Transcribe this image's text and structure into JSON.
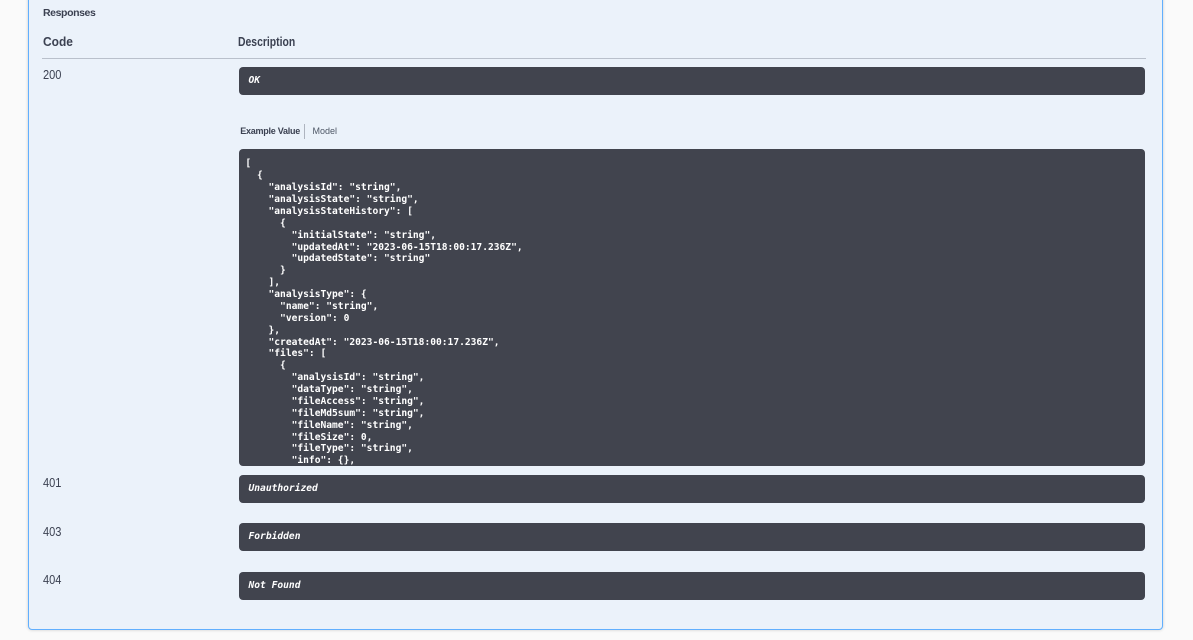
{
  "colors": {
    "panel_background": "#ebf2fa",
    "panel_border": "#61affe",
    "dark_block": "#41444e",
    "text": "#3b4151",
    "page_background": "#fafafa"
  },
  "responses_section": {
    "title": "Responses",
    "table": {
      "headers": {
        "code": "Code",
        "description": "Description"
      },
      "rows": [
        {
          "code": "200",
          "description": "OK",
          "tabs": [
            {
              "label": "Example Value",
              "active": true
            },
            {
              "label": "Model",
              "active": false
            }
          ],
          "example": "[\n  {\n    \"analysisId\": \"string\",\n    \"analysisState\": \"string\",\n    \"analysisStateHistory\": [\n      {\n        \"initialState\": \"string\",\n        \"updatedAt\": \"2023-06-15T18:00:17.236Z\",\n        \"updatedState\": \"string\"\n      }\n    ],\n    \"analysisType\": {\n      \"name\": \"string\",\n      \"version\": 0\n    },\n    \"createdAt\": \"2023-06-15T18:00:17.236Z\",\n    \"files\": [\n      {\n        \"analysisId\": \"string\",\n        \"dataType\": \"string\",\n        \"fileAccess\": \"string\",\n        \"fileMd5sum\": \"string\",\n        \"fileName\": \"string\",\n        \"fileSize\": 0,\n        \"fileType\": \"string\",\n        \"info\": {},"
        },
        {
          "code": "401",
          "description": "Unauthorized"
        },
        {
          "code": "403",
          "description": "Forbidden"
        },
        {
          "code": "404",
          "description": "Not Found"
        }
      ]
    }
  }
}
